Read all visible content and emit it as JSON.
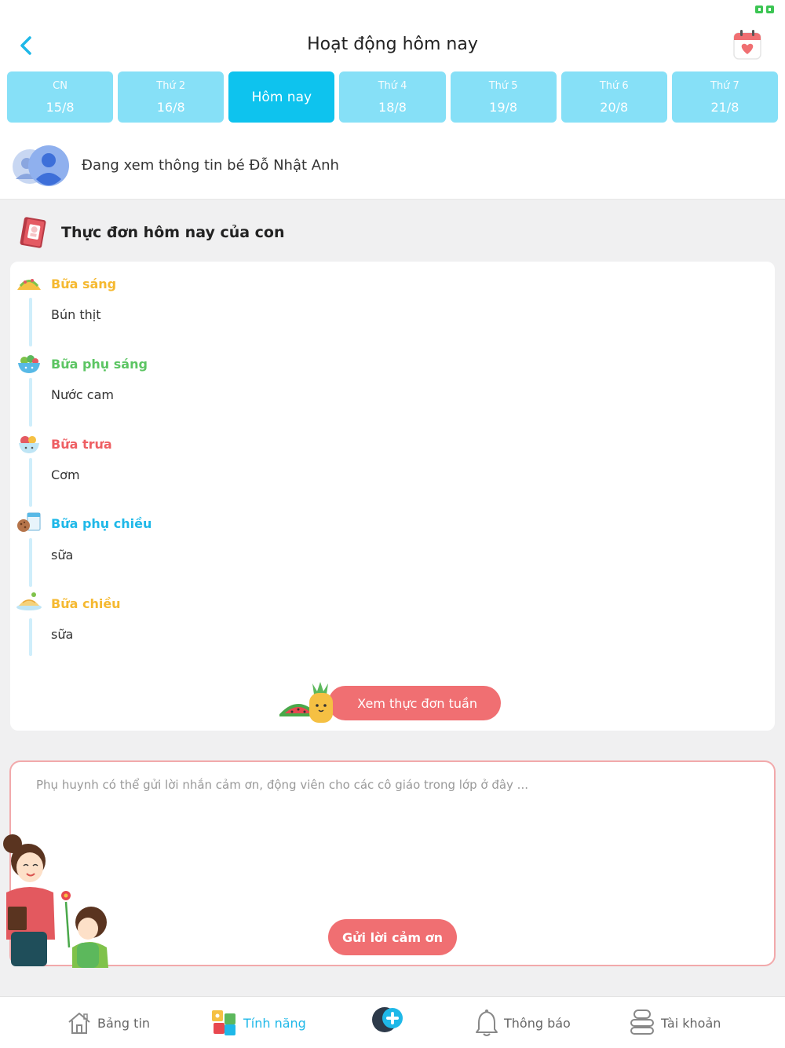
{
  "header": {
    "title": "Hoạt động hôm nay",
    "back_icon": "chevron-left-icon",
    "calendar_icon": "calendar-heart-icon",
    "accent_color": "#0ec3ee"
  },
  "days": [
    {
      "name": "CN",
      "date": "15/8"
    },
    {
      "name": "Thứ 2",
      "date": "16/8"
    },
    {
      "label": "Hôm nay",
      "active": true
    },
    {
      "name": "Thứ 4",
      "date": "18/8"
    },
    {
      "name": "Thứ 5",
      "date": "19/8"
    },
    {
      "name": "Thứ 6",
      "date": "20/8"
    },
    {
      "name": "Thứ 7",
      "date": "21/8"
    }
  ],
  "child": {
    "viewing_text": "Đang xem thông tin bé Đỗ Nhật Anh"
  },
  "menu": {
    "section_title": "Thực đơn hôm nay của con",
    "meals": [
      {
        "title": "Bữa sáng",
        "item": "Bún thịt",
        "color": "#f5b931",
        "icon": "taco-icon"
      },
      {
        "title": "Bữa phụ sáng",
        "item": "Nước cam",
        "color": "#5cc563",
        "icon": "salad-bowl-icon"
      },
      {
        "title": "Bữa trưa",
        "item": "Cơm",
        "color": "#ee5f63",
        "icon": "fruit-bowl-icon"
      },
      {
        "title": "Bữa phụ chiều",
        "item": "sữa",
        "color": "#1fb8e8",
        "icon": "milk-cookie-icon"
      },
      {
        "title": "Bữa chiều",
        "item": "sữa",
        "color": "#f5b931",
        "icon": "noodle-plate-icon"
      }
    ],
    "week_button": "Xem thực đơn tuần"
  },
  "thanks": {
    "placeholder": "Phụ huynh có thể gửi lời nhắn cảm ơn, động viên cho các cô giáo trong lớp ở đây ...",
    "send_button": "Gửi lời cảm ơn",
    "border_color": "#f2a9ab"
  },
  "nav": {
    "items": [
      {
        "label": "Bảng tin",
        "icon": "house-icon"
      },
      {
        "label": "Tính năng",
        "icon": "puzzle-icon",
        "active": true
      },
      {
        "label": "",
        "icon": "moon-plus-icon"
      },
      {
        "label": "Thông báo",
        "icon": "bell-icon"
      },
      {
        "label": "Tài khoản",
        "icon": "account-stack-icon"
      }
    ]
  }
}
